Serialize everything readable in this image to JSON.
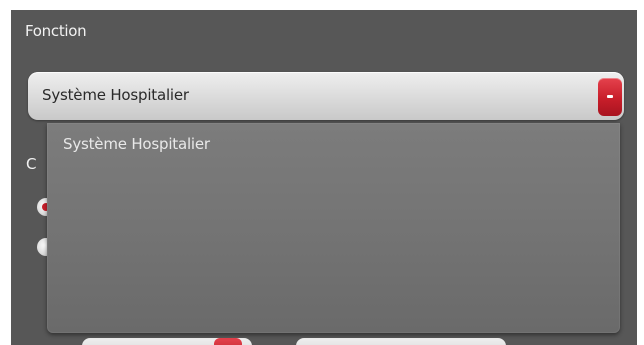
{
  "form": {
    "function_label": "Fonction",
    "selected_value": "Système Hospitalier",
    "hidden_label_fragment": "C"
  },
  "dropdown": {
    "options": [
      "Système Hospitalier"
    ]
  },
  "icons": {
    "select_arrow": "chevron-down-icon"
  },
  "colors": {
    "panel_background": "#575757",
    "accent_red": "#c81e2a",
    "dropdown_background": "#747474"
  }
}
